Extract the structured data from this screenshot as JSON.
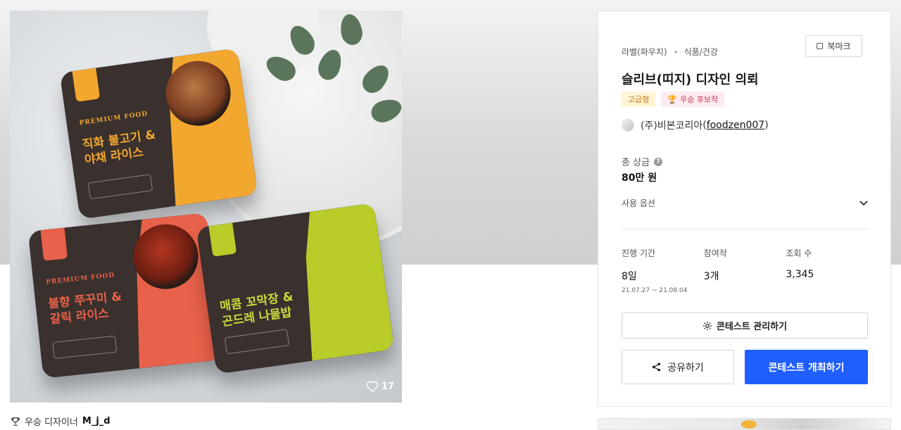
{
  "gallery": {
    "likes": "17",
    "products": [
      {
        "name_line1": "직화 불고기 &",
        "name_line2": "야채 라이스",
        "series": "PREMIUM FOOD"
      },
      {
        "name_line1": "불향 쭈꾸미 &",
        "name_line2": "갈릭 라이스",
        "series": "PREMIUM FOOD"
      },
      {
        "name_line1": "매콤 꼬막장 &",
        "name_line2": "곤드레 나물밥",
        "series": ""
      }
    ],
    "designer_prefix": "우승 디자이너",
    "designer_name": "M_j_d"
  },
  "panel": {
    "breadcrumb": [
      "라벨(파우치)",
      "식품/건강"
    ],
    "bookmark_label": "북마크",
    "title": "슬리브(띠지) 디자인 의뢰",
    "badges": {
      "grade": "고급형",
      "candidate": "우승 후보작"
    },
    "host": {
      "company": "(주)비본코리아",
      "id": "foodzen007",
      "open_paren": "(",
      "close_paren": ")"
    },
    "prize_label": "총 상금",
    "prize_value": "80만 원",
    "usage_label": "사용 옵션",
    "stats": {
      "duration_label": "진행 기간",
      "duration_value": "8일",
      "duration_range": "21.07.27 ~ 21.08.04",
      "entries_label": "참여작",
      "entries_value": "3개",
      "views_label": "조회 수",
      "views_value": "3,345"
    },
    "manage_label": "콘테스트 관리하기",
    "share_label": "공유하기",
    "host_contest_label": "콘테스트 개최하기"
  },
  "colors": {
    "primary": "#1f5eff",
    "grade_bg": "#fff4d6",
    "candidate_bg": "#fdebf0"
  }
}
